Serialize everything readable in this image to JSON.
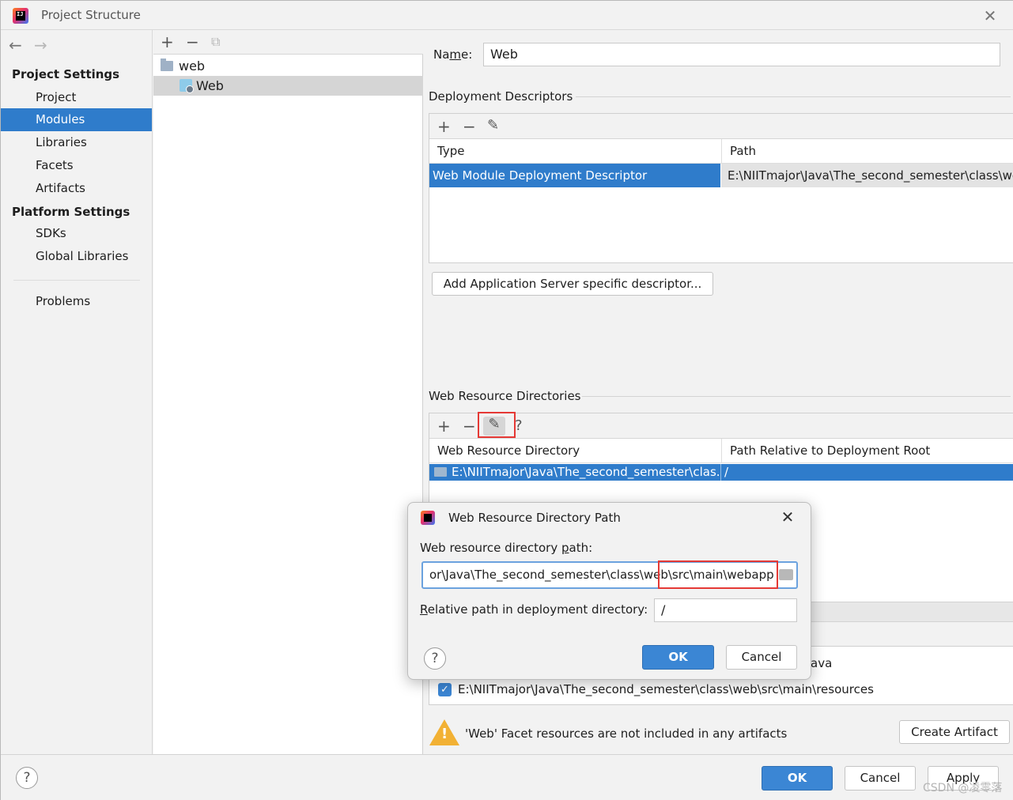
{
  "window": {
    "title": "Project Structure"
  },
  "nav": {
    "project_settings_heading": "Project Settings",
    "project_items": [
      "Project",
      "Modules",
      "Libraries",
      "Facets",
      "Artifacts"
    ],
    "selected_item": "Modules",
    "platform_settings_heading": "Platform Settings",
    "platform_items": [
      "SDKs",
      "Global Libraries"
    ],
    "problems": "Problems"
  },
  "tree": {
    "nodes": [
      {
        "label": "web",
        "icon": "folder-icon"
      },
      {
        "label": "Web",
        "icon": "web-facet-icon"
      }
    ]
  },
  "facet": {
    "name_label": "Name:",
    "name_value": "Web",
    "deployment_descriptors": {
      "title": "Deployment Descriptors",
      "columns": [
        "Type",
        "Path"
      ],
      "rows": [
        {
          "type": "Web Module Deployment Descriptor",
          "path": "E:\\NIITmajor\\Java\\The_second_semester\\class\\we"
        }
      ],
      "add_button": "Add Application Server specific descriptor..."
    },
    "web_resource_directories": {
      "title": "Web Resource Directories",
      "columns": [
        "Web Resource Directory",
        "Path Relative to Deployment Root"
      ],
      "rows": [
        {
          "directory": "E:\\NIITmajor\\Java\\The_second_semester\\clas...",
          "relative": "/"
        }
      ]
    },
    "source_roots": [
      {
        "checked": true,
        "path_partial": "ava"
      },
      {
        "checked": true,
        "path": "E:\\NIITmajor\\Java\\The_second_semester\\class\\web\\src\\main\\resources"
      }
    ],
    "warning_text": "'Web' Facet resources are not included in any artifacts",
    "create_artifact_button": "Create Artifact"
  },
  "footer": {
    "ok": "OK",
    "cancel": "Cancel",
    "apply": "Apply"
  },
  "dialog": {
    "title": "Web Resource Directory Path",
    "path_label": "Web resource directory path:",
    "path_value": "or\\Java\\The_second_semester\\class\\web\\src\\main\\webapp",
    "relative_label": "Relative path in deployment directory:",
    "relative_value": "/",
    "ok": "OK",
    "cancel": "Cancel"
  },
  "watermark": "CSDN @凌零落",
  "colors": {
    "selection": "#2f7ccb",
    "highlight_box": "#e53935",
    "primary_button": "#3b86d4"
  }
}
